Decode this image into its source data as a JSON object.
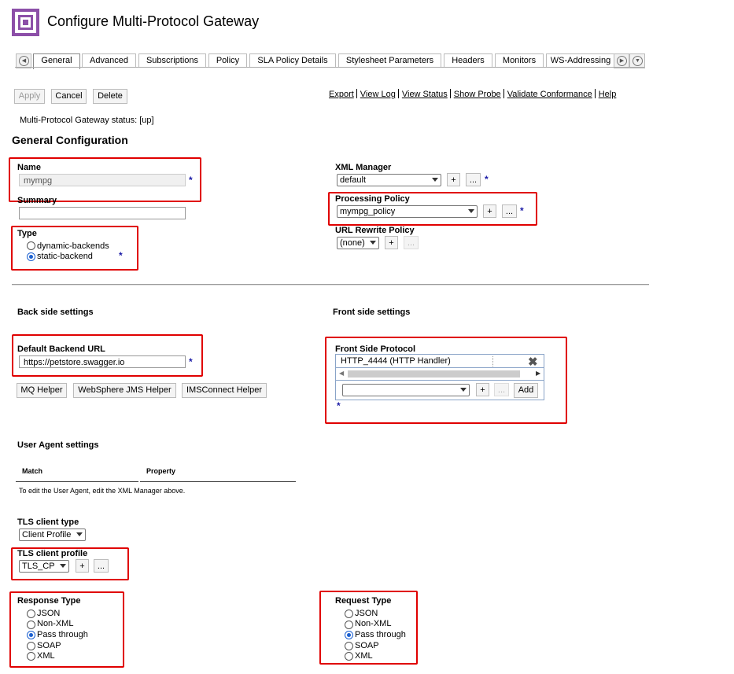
{
  "header": {
    "title": "Configure Multi-Protocol Gateway",
    "logo_icon": "datapower-logo-icon"
  },
  "tabs": [
    "General",
    "Advanced",
    "Subscriptions",
    "Policy",
    "SLA Policy Details",
    "Stylesheet Parameters",
    "Headers",
    "Monitors",
    "WS-Addressing"
  ],
  "toolbar": {
    "apply": "Apply",
    "cancel": "Cancel",
    "delete": "Delete"
  },
  "links": [
    "Export",
    "View Log",
    "View Status",
    "Show Probe",
    "Validate Conformance",
    "Help"
  ],
  "status": "Multi-Protocol Gateway status: [up]",
  "general": {
    "heading": "General Configuration",
    "name_label": "Name",
    "name_value": "mympg",
    "summary_label": "Summary",
    "summary_value": "",
    "type_label": "Type",
    "type_options": [
      "dynamic-backends",
      "static-backend"
    ],
    "type_selected": "static-backend",
    "xml_manager_label": "XML Manager",
    "xml_manager_value": "default",
    "processing_policy_label": "Processing Policy",
    "processing_policy_value": "mympg_policy",
    "url_rewrite_label": "URL Rewrite Policy",
    "url_rewrite_value": "(none)",
    "required_mark": "*",
    "plus": "+",
    "ellipsis": "..."
  },
  "backside": {
    "heading": "Back side settings",
    "url_label": "Default Backend URL",
    "url_value": "https://petstore.swagger.io",
    "helpers": [
      "MQ Helper",
      "WebSphere JMS Helper",
      "IMSConnect Helper"
    ]
  },
  "frontside": {
    "heading": "Front side settings",
    "protocol_label": "Front Side Protocol",
    "protocol_item": "HTTP_4444 (HTTP Handler)",
    "add_label": "Add"
  },
  "user_agent": {
    "heading": "User Agent settings",
    "columns": [
      "Match",
      "Property"
    ],
    "note": "To edit the User Agent, edit the XML Manager above."
  },
  "tls": {
    "client_type_label": "TLS client type",
    "client_type_value": "Client Profile",
    "client_profile_label": "TLS client profile",
    "client_profile_value": "TLS_CP"
  },
  "response_type": {
    "label": "Response Type",
    "options": [
      "JSON",
      "Non-XML",
      "Pass through",
      "SOAP",
      "XML"
    ],
    "selected": "Pass through"
  },
  "request_type": {
    "label": "Request Type",
    "options": [
      "JSON",
      "Non-XML",
      "Pass through",
      "SOAP",
      "XML"
    ],
    "selected": "Pass through"
  },
  "colors": {
    "brand": "#8c4fa8",
    "highlight": "#e00000",
    "required": "#1a1aa6"
  }
}
